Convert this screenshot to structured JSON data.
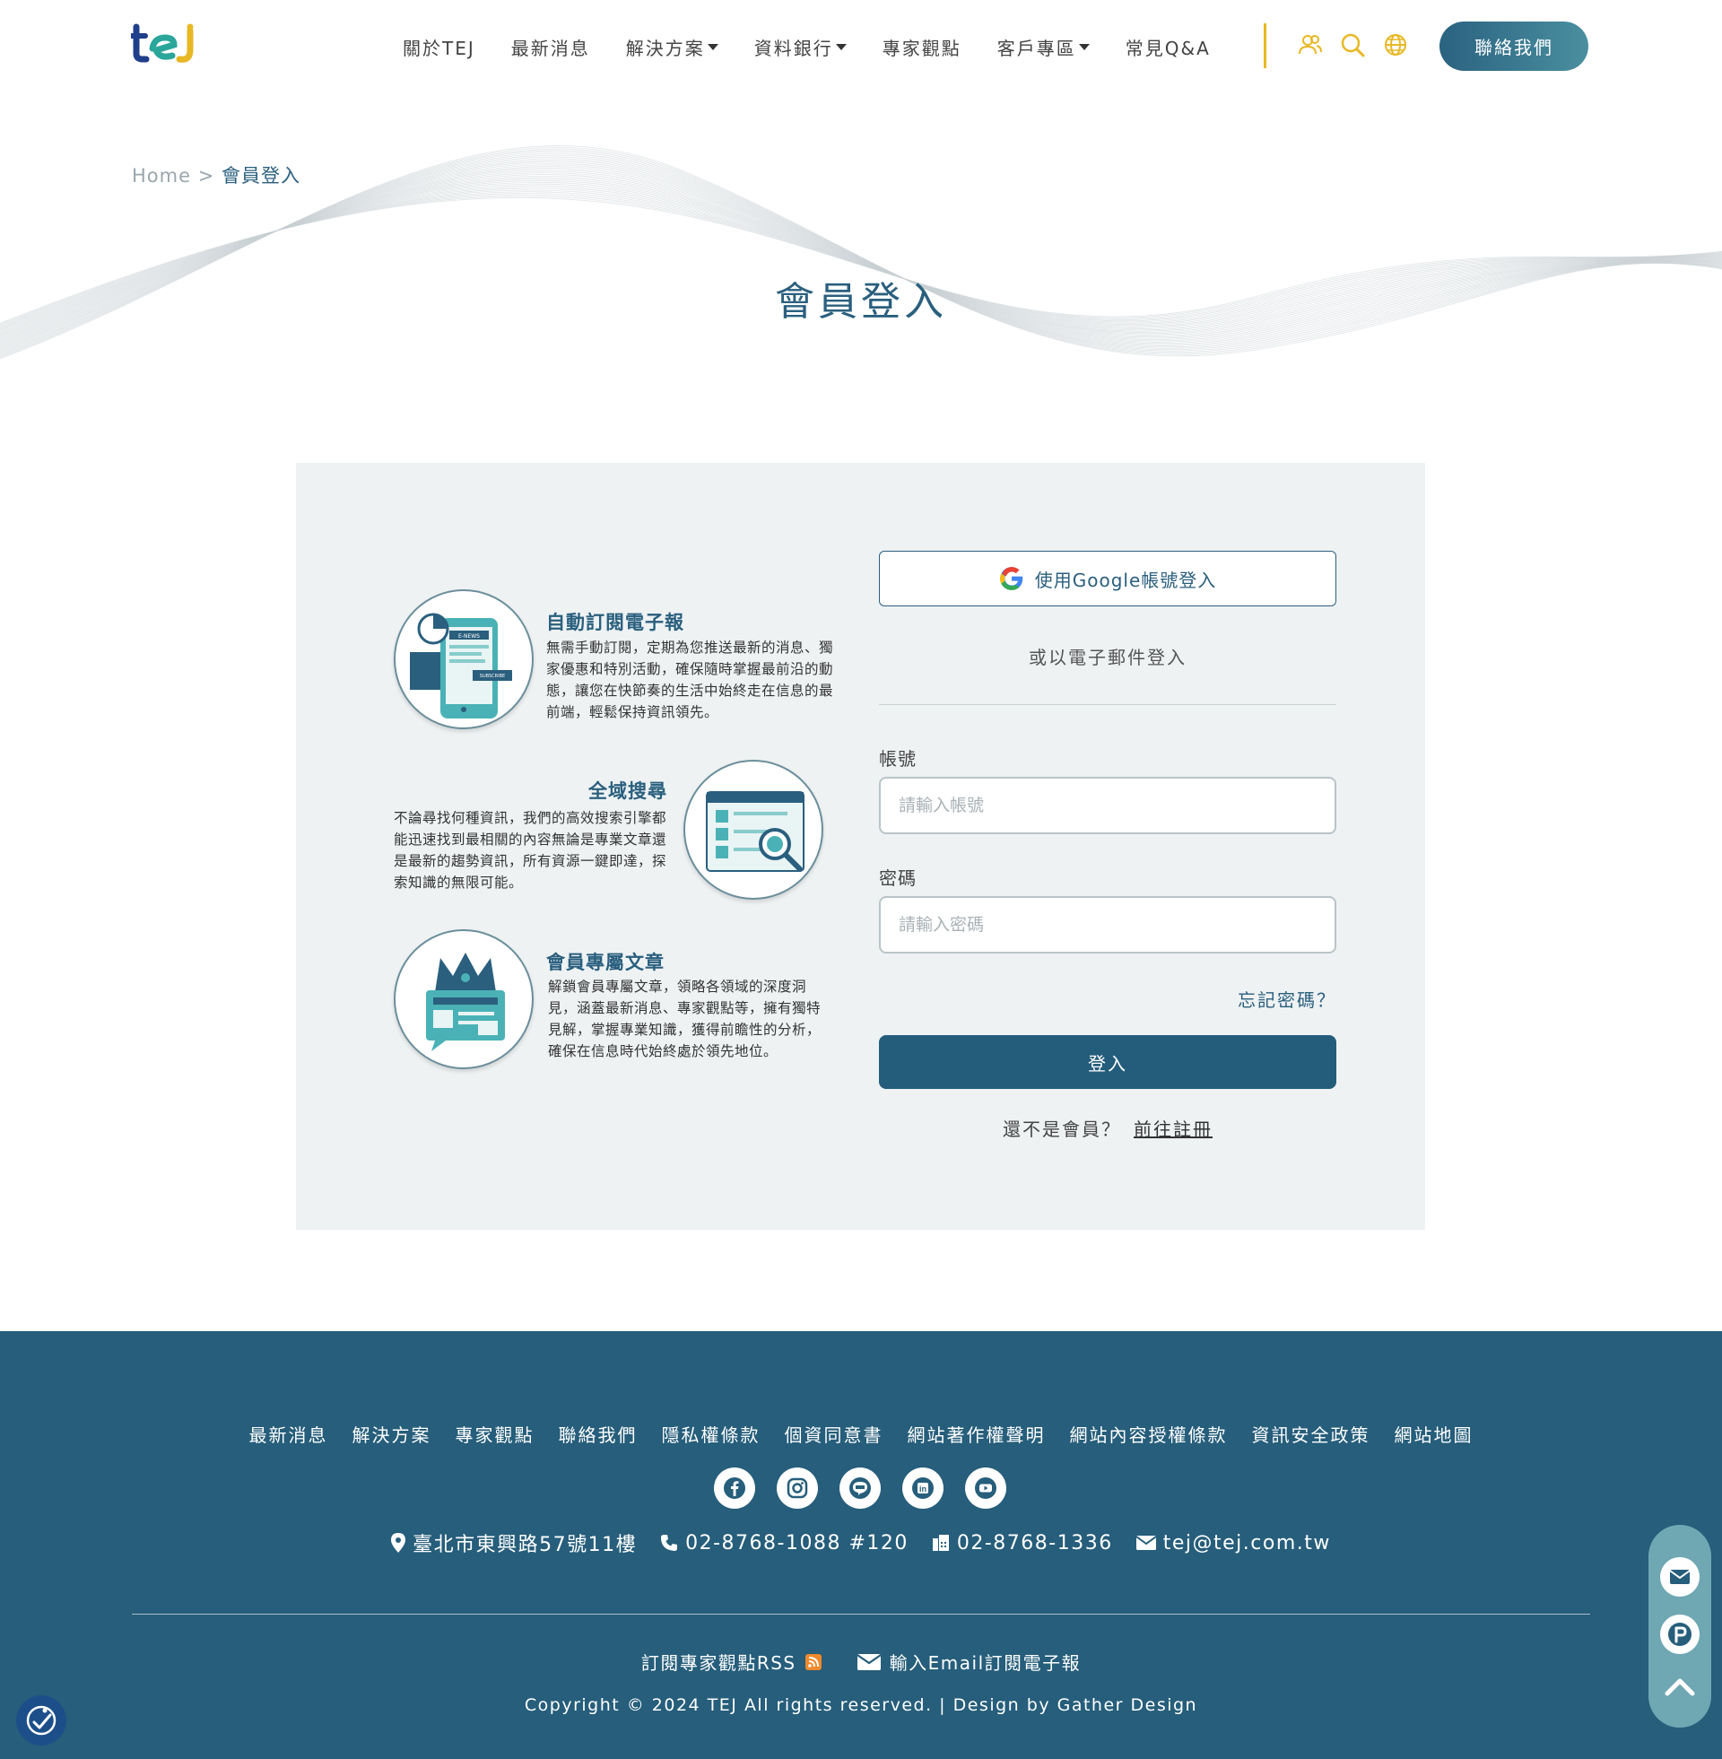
{
  "header": {
    "logo_text": "tej",
    "nav": [
      {
        "label": "關於TEJ",
        "dropdown": false
      },
      {
        "label": "最新消息",
        "dropdown": false
      },
      {
        "label": "解決方案",
        "dropdown": true
      },
      {
        "label": "資料銀行",
        "dropdown": true
      },
      {
        "label": "專家觀點",
        "dropdown": false
      },
      {
        "label": "客戶專區",
        "dropdown": true
      },
      {
        "label": "常見Q&A",
        "dropdown": false
      }
    ],
    "icons": [
      "user-icon",
      "search-icon",
      "globe-icon"
    ],
    "contact_label": "聯絡我們"
  },
  "breadcrumb": {
    "home": "Home",
    "separator": ">",
    "current": "會員登入"
  },
  "page_title": "會員登入",
  "features": [
    {
      "title": "自動訂閱電子報",
      "desc": "無需手動訂閱，定期為您推送最新的消息、獨家優惠和特別活動，確保隨時掌握最前沿的動態，讓您在快節奏的生活中始終走在信息的最前端，輕鬆保持資訊領先。",
      "illus_labels": [
        "E-NEWS",
        "SUBSCRIBE"
      ]
    },
    {
      "title": "全域搜尋",
      "desc": "不論尋找何種資訊，我們的高效搜索引擎都能迅速找到最相關的內容無論是專業文章還是最新的趨勢資訊，所有資源一鍵即達，探索知識的無限可能。"
    },
    {
      "title": "會員專屬文章",
      "desc": "解鎖會員專屬文章，領略各領域的深度洞見，涵蓋最新消息、專家觀點等，擁有獨特見解，掌握專業知識，獲得前瞻性的分析，確保在信息時代始終處於領先地位。"
    }
  ],
  "login": {
    "google_label": "使用Google帳號登入",
    "or_text": "或以電子郵件登入",
    "account_label": "帳號",
    "account_placeholder": "請輸入帳號",
    "password_label": "密碼",
    "password_placeholder": "請輸入密碼",
    "forgot_label": "忘記密碼？",
    "submit_label": "登入",
    "register_prompt": "還不是會員？",
    "register_link": "前往註冊"
  },
  "footer": {
    "links": [
      "最新消息",
      "解決方案",
      "專家觀點",
      "聯絡我們",
      "隱私權條款",
      "個資同意書",
      "網站著作權聲明",
      "網站內容授權條款",
      "資訊安全政策",
      "網站地圖"
    ],
    "social": [
      "facebook-icon",
      "instagram-icon",
      "line-icon",
      "linkedin-icon",
      "youtube-icon"
    ],
    "address": "臺北市東興路57號11樓",
    "phone": "02-8768-1088 #120",
    "fax": "02-8768-1336",
    "email": "tej@tej.com.tw",
    "rss_label": "訂閱專家觀點RSS",
    "newsletter_label": "輸入Email訂閱電子報",
    "copyright": "Copyright © 2024 TEJ All rights reserved. | Design by Gather Design"
  },
  "colors": {
    "primary": "#245d7b",
    "accent": "#e8b824",
    "panel": "#eef2f3",
    "footer": "#265e7b"
  }
}
